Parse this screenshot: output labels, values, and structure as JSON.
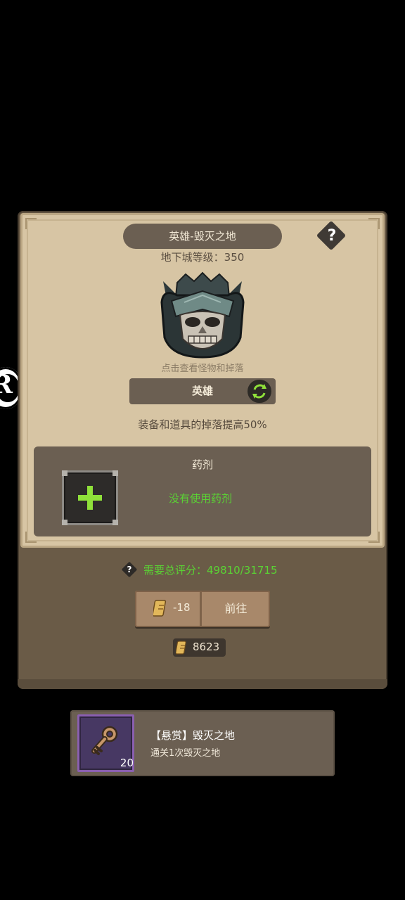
{
  "stage_title": "英雄-毁灭之地",
  "dungeon_level": "地下城等级：350",
  "monster_hint": "点击查看怪物和掉落",
  "difficulty": "英雄",
  "drop_bonus": "装备和道具的掉落提高50%",
  "help_symbol": "?",
  "potion": {
    "title": "药剂",
    "status": "没有使用药剂"
  },
  "score": {
    "text": "需要总评分：49810/31715"
  },
  "enter_button": {
    "cost": "-18",
    "label": "前往"
  },
  "currency": {
    "value": "8623"
  },
  "bounty": {
    "title": "【悬赏】毁灭之地",
    "description": "通关1次毁灭之地",
    "count": "20"
  },
  "colors": {
    "accent_green": "#5ad334",
    "plus_green": "#8fe03a",
    "parchment": "#d7c5a4",
    "panel_brown": "#6b5f52"
  },
  "icons": [
    "help-icon",
    "swap-icon",
    "plus-icon",
    "scroll-ticket-icon",
    "key-icon",
    "monster-helmet-icon"
  ]
}
